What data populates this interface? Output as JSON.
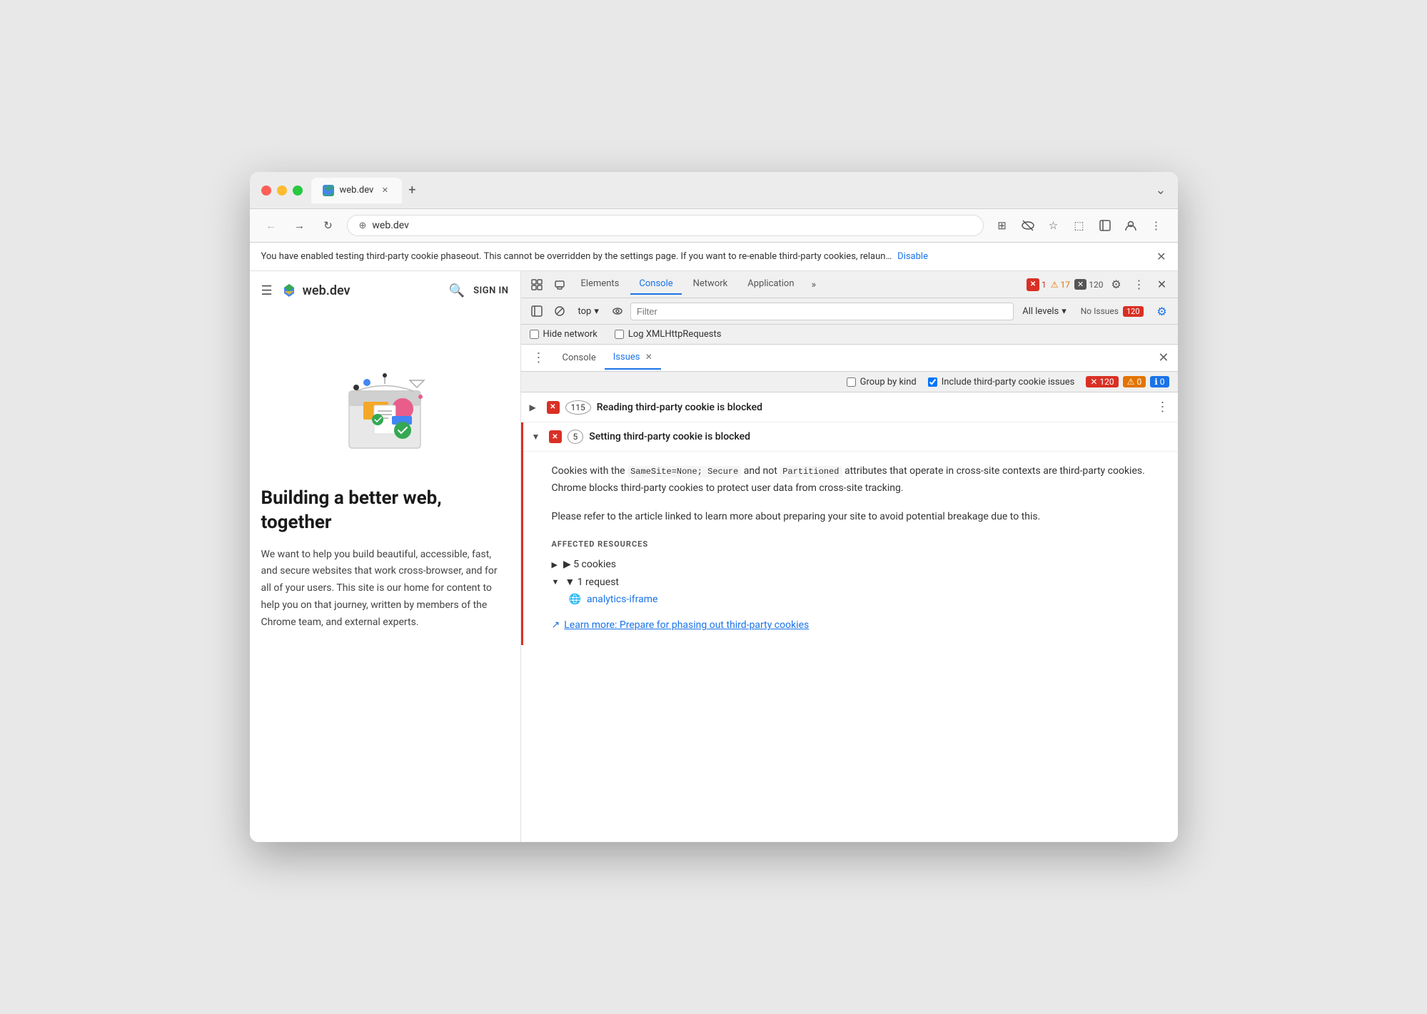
{
  "window": {
    "title": "web.dev"
  },
  "browser": {
    "tab_label": "web.dev",
    "tab_url": "web.dev",
    "new_tab_label": "+",
    "back_btn": "‹",
    "forward_btn": "›",
    "reload_btn": "↻",
    "url": "web.dev",
    "chevron_down": "⌄"
  },
  "infobar": {
    "text": "You have enabled testing third-party cookie phaseout. This cannot be overridden by the settings page. If you want to re-enable third-party cookies, relaun…",
    "link_text": "Disable"
  },
  "sidebar": {
    "site_name": "web.dev",
    "sign_in": "SIGN IN",
    "hero_title": "Building a better web, together",
    "hero_body": "We want to help you build beautiful, accessible, fast, and secure websites that work cross-browser, and for all of your users. This site is our home for content to help you on that journey, written by members of the Chrome team, and external experts."
  },
  "devtools": {
    "tabs": [
      {
        "label": "Elements",
        "active": false
      },
      {
        "label": "Console",
        "active": false
      },
      {
        "label": "Network",
        "active": false
      },
      {
        "label": "Application",
        "active": false
      }
    ],
    "active_tab": "Console",
    "more_tabs_label": "»",
    "errors_count": "1",
    "warnings_count": "17",
    "info_count": "120",
    "gear_icon": "⚙",
    "more_icon": "⋮",
    "close_icon": "✕",
    "toolbar": {
      "context_label": "top",
      "filter_placeholder": "Filter",
      "levels_label": "All levels",
      "levels_chevron": "▾",
      "no_issues_text": "No Issues",
      "no_issues_count": "120"
    },
    "checkboxes": {
      "hide_network": "Hide network",
      "log_xhr": "Log XMLHttpRequests"
    },
    "issues_tabs": [
      {
        "label": "Console",
        "active": false
      },
      {
        "label": "Issues",
        "active": true,
        "closable": true
      }
    ],
    "filter_bar": {
      "group_by_kind": "Group by kind",
      "include_third_party": "Include third-party cookie issues",
      "include_third_party_checked": true,
      "count_120": "120",
      "count_0_orange": "0",
      "count_0_blue": "0"
    },
    "issues": [
      {
        "id": "reading-cookie",
        "expanded": false,
        "count": "115",
        "title": "Reading third-party cookie is blocked"
      },
      {
        "id": "setting-cookie",
        "expanded": true,
        "count": "5",
        "title": "Setting third-party cookie is blocked",
        "description1": "Cookies with the",
        "code1": "SameSite=None; Secure",
        "desc_mid": "and not",
        "code2": "Partitioned",
        "description1_end": "attributes that operate in cross-site contexts are third-party cookies. Chrome blocks third-party cookies to protect user data from cross-site tracking.",
        "description2": "Please refer to the article linked to learn more about preparing your site to avoid potential breakage due to this.",
        "affected_title": "AFFECTED RESOURCES",
        "resource1": "▶ 5 cookies",
        "resource2": "▼ 1 request",
        "resource3": "analytics-iframe",
        "learn_more_text": "Learn more: Prepare for phasing out third-party cookies"
      }
    ]
  }
}
